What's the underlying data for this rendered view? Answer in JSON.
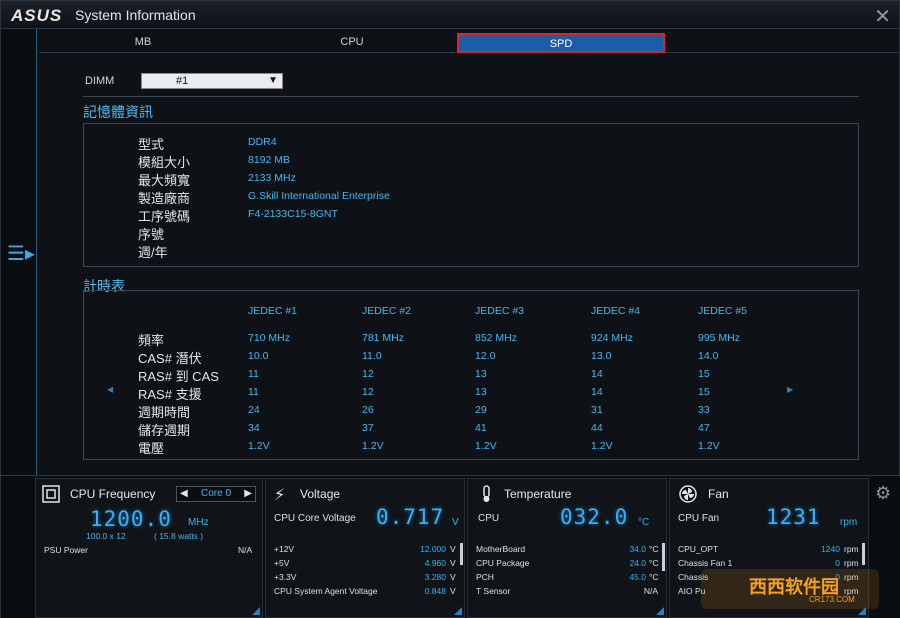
{
  "window": {
    "logo": "ASUS",
    "title": "System Information"
  },
  "tabs": [
    {
      "label": "MB"
    },
    {
      "label": "CPU"
    },
    {
      "label": "SPD"
    }
  ],
  "dimm": {
    "label": "DIMM",
    "selected": "#1"
  },
  "memory_info": {
    "title": "記憶體資訊",
    "rows": [
      {
        "label": "型式",
        "value": "DDR4"
      },
      {
        "label": "模組大小",
        "value": "8192 MB"
      },
      {
        "label": "最大頻寬",
        "value": "2133 MHz"
      },
      {
        "label": "製造廠商",
        "value": "G.Skill International Enterprise"
      },
      {
        "label": "工序號碼",
        "value": "F4-2133C15-8GNT"
      },
      {
        "label": "序號",
        "value": ""
      },
      {
        "label": "週/年",
        "value": ""
      }
    ]
  },
  "timing": {
    "title": "計時表",
    "headers": [
      "JEDEC #1",
      "JEDEC #2",
      "JEDEC #3",
      "JEDEC #4",
      "JEDEC #5"
    ],
    "rows": [
      {
        "label": "頻率",
        "values": [
          "710 MHz",
          "781 MHz",
          "852 MHz",
          "924 MHz",
          "995 MHz"
        ]
      },
      {
        "label": "CAS# 潛伏",
        "values": [
          "10.0",
          "11.0",
          "12.0",
          "13.0",
          "14.0"
        ]
      },
      {
        "label": "RAS# 到 CAS",
        "values": [
          "11",
          "12",
          "13",
          "14",
          "15"
        ]
      },
      {
        "label": "RAS# 支援",
        "values": [
          "11",
          "12",
          "13",
          "14",
          "15"
        ]
      },
      {
        "label": "週期時間",
        "values": [
          "24",
          "26",
          "29",
          "31",
          "33"
        ]
      },
      {
        "label": "儲存週期",
        "values": [
          "34",
          "37",
          "41",
          "44",
          "47"
        ]
      },
      {
        "label": "電壓",
        "values": [
          "1.2V",
          "1.2V",
          "1.2V",
          "1.2V",
          "1.2V"
        ]
      }
    ]
  },
  "cpu_freq": {
    "title": "CPU Frequency",
    "core": "Core 0",
    "value": "1200.0",
    "unit": "MHz",
    "multiplier": "100.0  x  12",
    "watts": "( 15.8 watts )",
    "psu_label": "PSU Power",
    "psu_value": "N/A"
  },
  "voltage": {
    "title": "Voltage",
    "main_label": "CPU Core Voltage",
    "value": "0.717",
    "unit": "V",
    "rows": [
      {
        "label": "+12V",
        "value": "12.000",
        "unit": "V"
      },
      {
        "label": "+5V",
        "value": "4.960",
        "unit": "V"
      },
      {
        "label": "+3.3V",
        "value": "3.280",
        "unit": "V"
      },
      {
        "label": "CPU System Agent Voltage",
        "value": "0.848",
        "unit": "V"
      }
    ]
  },
  "temperature": {
    "title": "Temperature",
    "main_label": "CPU",
    "value": "032.0",
    "unit": "°C",
    "rows": [
      {
        "label": "MotherBoard",
        "value": "34.0",
        "unit": "°C"
      },
      {
        "label": "CPU Package",
        "value": "24.0",
        "unit": "°C"
      },
      {
        "label": "PCH",
        "value": "45.0",
        "unit": "°C"
      },
      {
        "label": "T Sensor",
        "value": "N/A",
        "unit": ""
      }
    ]
  },
  "fan": {
    "title": "Fan",
    "main_label": "CPU Fan",
    "value": "1231",
    "unit": "rpm",
    "rows": [
      {
        "label": "CPU_OPT",
        "value": "1240",
        "unit": "rpm"
      },
      {
        "label": "Chassis Fan 1",
        "value": "0",
        "unit": "rpm"
      },
      {
        "label": "Chassis",
        "value": "0",
        "unit": "rpm"
      },
      {
        "label": "AIO Pu",
        "value": "",
        "unit": "rpm"
      }
    ]
  },
  "watermark": {
    "text": "西西软件园",
    "sub": "CR173.COM"
  },
  "colors": {
    "accent": "#3ab0f0",
    "active_tab": "#1b5ea8",
    "tab_border": "#d8262b"
  }
}
